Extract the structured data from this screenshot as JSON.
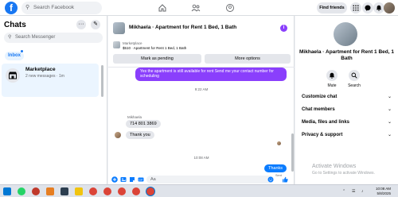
{
  "topbar": {
    "logo": "f",
    "search_placeholder": "Search Facebook",
    "find_friends": "Find friends",
    "icons": [
      "home-icon",
      "friends-icon",
      "groups-icon",
      "menu-grid-icon",
      "messenger-icon",
      "bell-icon",
      "profile-avatar"
    ]
  },
  "sidebar": {
    "title": "Chats",
    "more_button": "···",
    "compose_button": "✎",
    "search_placeholder": "Search Messenger",
    "tab_inbox": "Inbox",
    "items": [
      {
        "title": "Marketplace",
        "subtitle": "2 new messages · 1m"
      }
    ]
  },
  "chat": {
    "title": "Mikhaela · Apartment for Rent 1 Bed, 1 Bath",
    "info_icon": "i",
    "listing_title": "Marketplace",
    "listing_price": "$510 · Apartment for Rent 1 Bed, 1 Bath",
    "btn_mark_pending": "Mark as pending",
    "btn_more_options": "More options",
    "messages": {
      "m1_text": "Yes the apartment is still available for rent Send me your contact number for scheduling",
      "time1": "9:22 AM",
      "sender_name": "Mikhaela",
      "m2_text": "714 801 3869",
      "m3_text": "Thank you",
      "time2": "10:08 AM",
      "m4_text": "Thanks",
      "m4_status": "Sent"
    },
    "composer_placeholder": "Aa"
  },
  "right_panel": {
    "name": "Mikhaela · Apartment for Rent 1 Bed, 1 Bath",
    "mute_label": "Mute",
    "search_label": "Search",
    "sections": [
      "Customize chat",
      "Chat members",
      "Media, files and links",
      "Privacy & support"
    ]
  },
  "watermark": {
    "line1": "Activate Windows",
    "line2": "Go to Settings to activate Windows."
  },
  "taskbar": {
    "time": "10:08 AM",
    "date": "5/8/2025"
  },
  "colors": {
    "brand": "#1877f2",
    "accent_purple": "#8a3ffc",
    "sent_blue": "#0a7cff"
  }
}
